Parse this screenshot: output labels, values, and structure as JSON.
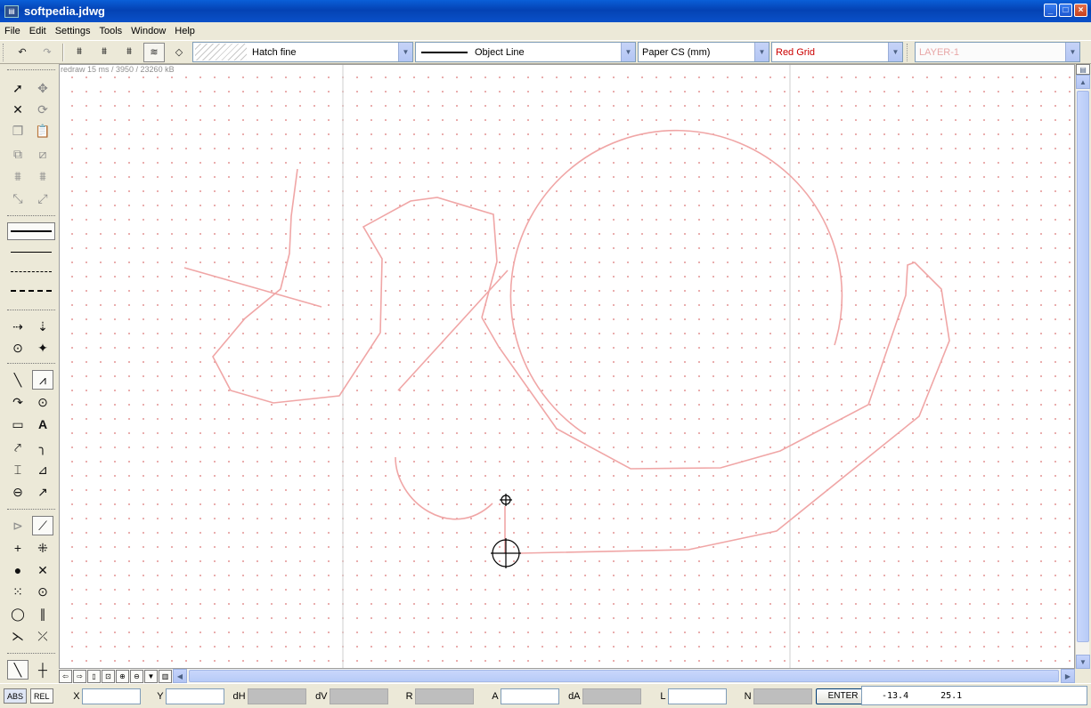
{
  "window": {
    "title": "softpedia.jdwg",
    "icon": "app-icon",
    "controls": [
      "_",
      "□",
      "×"
    ]
  },
  "menu": [
    "File",
    "Edit",
    "Settings",
    "Tools",
    "Window",
    "Help"
  ],
  "toolbar": {
    "undo_icon": "undo-icon",
    "redo_icon": "redo-icon",
    "hatch": "Hatch fine",
    "linetype": "Object Line",
    "coordsys": "Paper CS (mm)",
    "grid": "Red Grid",
    "grid_color": "#cc0000",
    "layer": "LAYER-1",
    "layer_color": "#e8a7a7"
  },
  "canvas": {
    "info": "redraw 15 ms / 3950 / 23260 kB",
    "stroke_color": "#f0a6a6",
    "grid_color": "#e6a0a0"
  },
  "statusbar": {
    "abs": "ABS",
    "rel": "REL",
    "fields": [
      "X",
      "Y",
      "dH",
      "dV",
      "R",
      "A",
      "dA",
      "L",
      "N"
    ],
    "enter": "ENTER",
    "coord_x": "-13.4",
    "coord_y": "25.1"
  }
}
